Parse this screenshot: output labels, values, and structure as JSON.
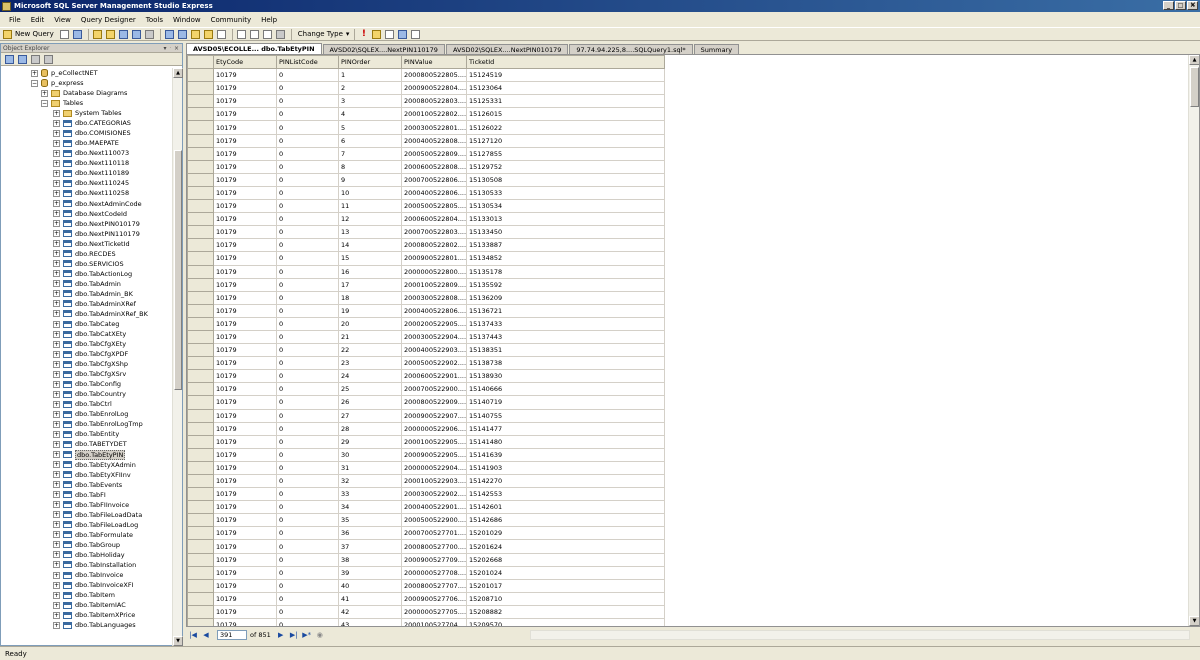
{
  "window": {
    "title": "Microsoft SQL Server Management Studio Express"
  },
  "menu": [
    "File",
    "Edit",
    "View",
    "Query Designer",
    "Tools",
    "Window",
    "Community",
    "Help"
  ],
  "toolbar": {
    "new_query": "New Query",
    "change_type": "Change Type",
    "change_type_arrow": "▾",
    "execute_glyph": "!"
  },
  "explorer": {
    "title": "Object Explorer",
    "nodes": [
      {
        "label": "p_eCollectNET",
        "level": 0,
        "exp": "+",
        "icon": "db"
      },
      {
        "label": "p_express",
        "level": 0,
        "exp": "−",
        "icon": "db"
      },
      {
        "label": "Database Diagrams",
        "level": 1,
        "exp": "+",
        "icon": "folder"
      },
      {
        "label": "Tables",
        "level": 1,
        "exp": "−",
        "icon": "folder"
      },
      {
        "label": "System Tables",
        "level": 2,
        "exp": "+",
        "icon": "folder"
      },
      {
        "label": "dbo.CATEGORIAS",
        "level": 2,
        "exp": "+",
        "icon": "table"
      },
      {
        "label": "dbo.COMISIONES",
        "level": 2,
        "exp": "+",
        "icon": "table"
      },
      {
        "label": "dbo.MAEPATE",
        "level": 2,
        "exp": "+",
        "icon": "table"
      },
      {
        "label": "dbo.Next110073",
        "level": 2,
        "exp": "+",
        "icon": "table"
      },
      {
        "label": "dbo.Next110118",
        "level": 2,
        "exp": "+",
        "icon": "table"
      },
      {
        "label": "dbo.Next110189",
        "level": 2,
        "exp": "+",
        "icon": "table"
      },
      {
        "label": "dbo.Next110245",
        "level": 2,
        "exp": "+",
        "icon": "table"
      },
      {
        "label": "dbo.Next110258",
        "level": 2,
        "exp": "+",
        "icon": "table"
      },
      {
        "label": "dbo.NextAdminCode",
        "level": 2,
        "exp": "+",
        "icon": "table"
      },
      {
        "label": "dbo.NextCodeId",
        "level": 2,
        "exp": "+",
        "icon": "table"
      },
      {
        "label": "dbo.NextPIN010179",
        "level": 2,
        "exp": "+",
        "icon": "table"
      },
      {
        "label": "dbo.NextPIN110179",
        "level": 2,
        "exp": "+",
        "icon": "table"
      },
      {
        "label": "dbo.NextTicketId",
        "level": 2,
        "exp": "+",
        "icon": "table"
      },
      {
        "label": "dbo.RECDES",
        "level": 2,
        "exp": "+",
        "icon": "table"
      },
      {
        "label": "dbo.SERVICIOS",
        "level": 2,
        "exp": "+",
        "icon": "table"
      },
      {
        "label": "dbo.TabActionLog",
        "level": 2,
        "exp": "+",
        "icon": "table"
      },
      {
        "label": "dbo.TabAdmin",
        "level": 2,
        "exp": "+",
        "icon": "table"
      },
      {
        "label": "dbo.TabAdmin_BK",
        "level": 2,
        "exp": "+",
        "icon": "table"
      },
      {
        "label": "dbo.TabAdminXRef",
        "level": 2,
        "exp": "+",
        "icon": "table"
      },
      {
        "label": "dbo.TabAdminXRef_BK",
        "level": 2,
        "exp": "+",
        "icon": "table"
      },
      {
        "label": "dbo.TabCateg",
        "level": 2,
        "exp": "+",
        "icon": "table"
      },
      {
        "label": "dbo.TabCatXEty",
        "level": 2,
        "exp": "+",
        "icon": "table"
      },
      {
        "label": "dbo.TabCfgXEty",
        "level": 2,
        "exp": "+",
        "icon": "table"
      },
      {
        "label": "dbo.TabCfgXPDF",
        "level": 2,
        "exp": "+",
        "icon": "table"
      },
      {
        "label": "dbo.TabCfgXShp",
        "level": 2,
        "exp": "+",
        "icon": "table"
      },
      {
        "label": "dbo.TabCfgXSrv",
        "level": 2,
        "exp": "+",
        "icon": "table"
      },
      {
        "label": "dbo.TabConfig",
        "level": 2,
        "exp": "+",
        "icon": "table"
      },
      {
        "label": "dbo.TabCountry",
        "level": 2,
        "exp": "+",
        "icon": "table"
      },
      {
        "label": "dbo.TabCtrl",
        "level": 2,
        "exp": "+",
        "icon": "table"
      },
      {
        "label": "dbo.TabEnrolLog",
        "level": 2,
        "exp": "+",
        "icon": "table"
      },
      {
        "label": "dbo.TabEnrolLogTmp",
        "level": 2,
        "exp": "+",
        "icon": "table"
      },
      {
        "label": "dbo.TabEntity",
        "level": 2,
        "exp": "+",
        "icon": "table"
      },
      {
        "label": "dbo.TABETYDET",
        "level": 2,
        "exp": "+",
        "icon": "table"
      },
      {
        "label": "dbo.TabEtyPIN",
        "level": 2,
        "exp": "+",
        "icon": "table",
        "selected": true
      },
      {
        "label": "dbo.TabEtyXAdmin",
        "level": 2,
        "exp": "+",
        "icon": "table"
      },
      {
        "label": "dbo.TabEtyXFIInv",
        "level": 2,
        "exp": "+",
        "icon": "table"
      },
      {
        "label": "dbo.TabEvents",
        "level": 2,
        "exp": "+",
        "icon": "table"
      },
      {
        "label": "dbo.TabFI",
        "level": 2,
        "exp": "+",
        "icon": "table"
      },
      {
        "label": "dbo.TabFIInvoice",
        "level": 2,
        "exp": "+",
        "icon": "table"
      },
      {
        "label": "dbo.TabFileLoadData",
        "level": 2,
        "exp": "+",
        "icon": "table"
      },
      {
        "label": "dbo.TabFileLoadLog",
        "level": 2,
        "exp": "+",
        "icon": "table"
      },
      {
        "label": "dbo.TabFormulate",
        "level": 2,
        "exp": "+",
        "icon": "table"
      },
      {
        "label": "dbo.TabGroup",
        "level": 2,
        "exp": "+",
        "icon": "table"
      },
      {
        "label": "dbo.TabHoliday",
        "level": 2,
        "exp": "+",
        "icon": "table"
      },
      {
        "label": "dbo.TabInstallation",
        "level": 2,
        "exp": "+",
        "icon": "table"
      },
      {
        "label": "dbo.TabInvoice",
        "level": 2,
        "exp": "+",
        "icon": "table"
      },
      {
        "label": "dbo.TabInvoiceXFI",
        "level": 2,
        "exp": "+",
        "icon": "table"
      },
      {
        "label": "dbo.TabItem",
        "level": 2,
        "exp": "+",
        "icon": "table"
      },
      {
        "label": "dbo.TabItemIAC",
        "level": 2,
        "exp": "+",
        "icon": "table"
      },
      {
        "label": "dbo.TabItemXPrice",
        "level": 2,
        "exp": "+",
        "icon": "table"
      },
      {
        "label": "dbo.TabLanguages",
        "level": 2,
        "exp": "+",
        "icon": "table"
      }
    ]
  },
  "tabs": [
    {
      "label": "AVSD05\\ECOLLE... dbo.TabEtyPIN",
      "active": true
    },
    {
      "label": "AVSD02\\SQLEX....NextPIN110179",
      "active": false
    },
    {
      "label": "AVSD02\\SQLEX....NextPIN010179",
      "active": false
    },
    {
      "label": "97.74.94.225,8....SQLQuery1.sql*",
      "active": false
    },
    {
      "label": "Summary",
      "active": false
    }
  ],
  "close_glyph": "✕",
  "grid": {
    "columns": [
      "EtyCode",
      "PINListCode",
      "PINOrder",
      "PINValue",
      "TicketId"
    ],
    "rows": [
      [
        "10179",
        "0",
        "1",
        "2000800522805....",
        "15124519"
      ],
      [
        "10179",
        "0",
        "2",
        "2000900522804....",
        "15123064"
      ],
      [
        "10179",
        "0",
        "3",
        "2000800522803....",
        "15125331"
      ],
      [
        "10179",
        "0",
        "4",
        "2000100522802....",
        "15126015"
      ],
      [
        "10179",
        "0",
        "5",
        "2000300522801....",
        "15126022"
      ],
      [
        "10179",
        "0",
        "6",
        "2000400522808....",
        "15127120"
      ],
      [
        "10179",
        "0",
        "7",
        "2000500522809....",
        "15127855"
      ],
      [
        "10179",
        "0",
        "8",
        "2000600522808....",
        "15129752"
      ],
      [
        "10179",
        "0",
        "9",
        "2000700522806....",
        "15130508"
      ],
      [
        "10179",
        "0",
        "10",
        "2000400522806....",
        "15130533"
      ],
      [
        "10179",
        "0",
        "11",
        "2000500522805....",
        "15130534"
      ],
      [
        "10179",
        "0",
        "12",
        "2000600522804....",
        "15133013"
      ],
      [
        "10179",
        "0",
        "13",
        "2000700522803....",
        "15133450"
      ],
      [
        "10179",
        "0",
        "14",
        "2000800522802....",
        "15133887"
      ],
      [
        "10179",
        "0",
        "15",
        "2000900522801....",
        "15134852"
      ],
      [
        "10179",
        "0",
        "16",
        "2000000522800....",
        "15135178"
      ],
      [
        "10179",
        "0",
        "17",
        "2000100522809....",
        "15135592"
      ],
      [
        "10179",
        "0",
        "18",
        "2000300522808....",
        "15136209"
      ],
      [
        "10179",
        "0",
        "19",
        "2000400522806....",
        "15136721"
      ],
      [
        "10179",
        "0",
        "20",
        "2000200522905....",
        "15137433"
      ],
      [
        "10179",
        "0",
        "21",
        "2000300522904....",
        "15137443"
      ],
      [
        "10179",
        "0",
        "22",
        "2000400522903....",
        "15138351"
      ],
      [
        "10179",
        "0",
        "23",
        "2000500522902....",
        "15138738"
      ],
      [
        "10179",
        "0",
        "24",
        "2000600522901....",
        "15138930"
      ],
      [
        "10179",
        "0",
        "25",
        "2000700522900....",
        "15140666"
      ],
      [
        "10179",
        "0",
        "26",
        "2000800522909....",
        "15140719"
      ],
      [
        "10179",
        "0",
        "27",
        "2000900522907....",
        "15140755"
      ],
      [
        "10179",
        "0",
        "28",
        "2000000522906....",
        "15141477"
      ],
      [
        "10179",
        "0",
        "29",
        "2000100522905....",
        "15141480"
      ],
      [
        "10179",
        "0",
        "30",
        "2000900522905....",
        "15141639"
      ],
      [
        "10179",
        "0",
        "31",
        "2000000522904....",
        "15141903"
      ],
      [
        "10179",
        "0",
        "32",
        "2000100522903....",
        "15142270"
      ],
      [
        "10179",
        "0",
        "33",
        "2000300522902....",
        "15142553"
      ],
      [
        "10179",
        "0",
        "34",
        "2000400522901....",
        "15142601"
      ],
      [
        "10179",
        "0",
        "35",
        "2000500522900....",
        "15142686"
      ],
      [
        "10179",
        "0",
        "36",
        "2000700527701....",
        "15201029"
      ],
      [
        "10179",
        "0",
        "37",
        "2000800527700....",
        "15201624"
      ],
      [
        "10179",
        "0",
        "38",
        "2000900527709....",
        "15202668"
      ],
      [
        "10179",
        "0",
        "39",
        "2000000527708....",
        "15201024"
      ],
      [
        "10179",
        "0",
        "40",
        "2000800527707....",
        "15201017"
      ],
      [
        "10179",
        "0",
        "41",
        "2000900527706....",
        "15208710"
      ],
      [
        "10179",
        "0",
        "42",
        "2000000527705....",
        "15208882"
      ],
      [
        "10179",
        "0",
        "43",
        "2000100527704....",
        "15209570"
      ]
    ]
  },
  "navigator": {
    "current": "391",
    "total": "of 851"
  },
  "status": {
    "text": "Ready"
  }
}
